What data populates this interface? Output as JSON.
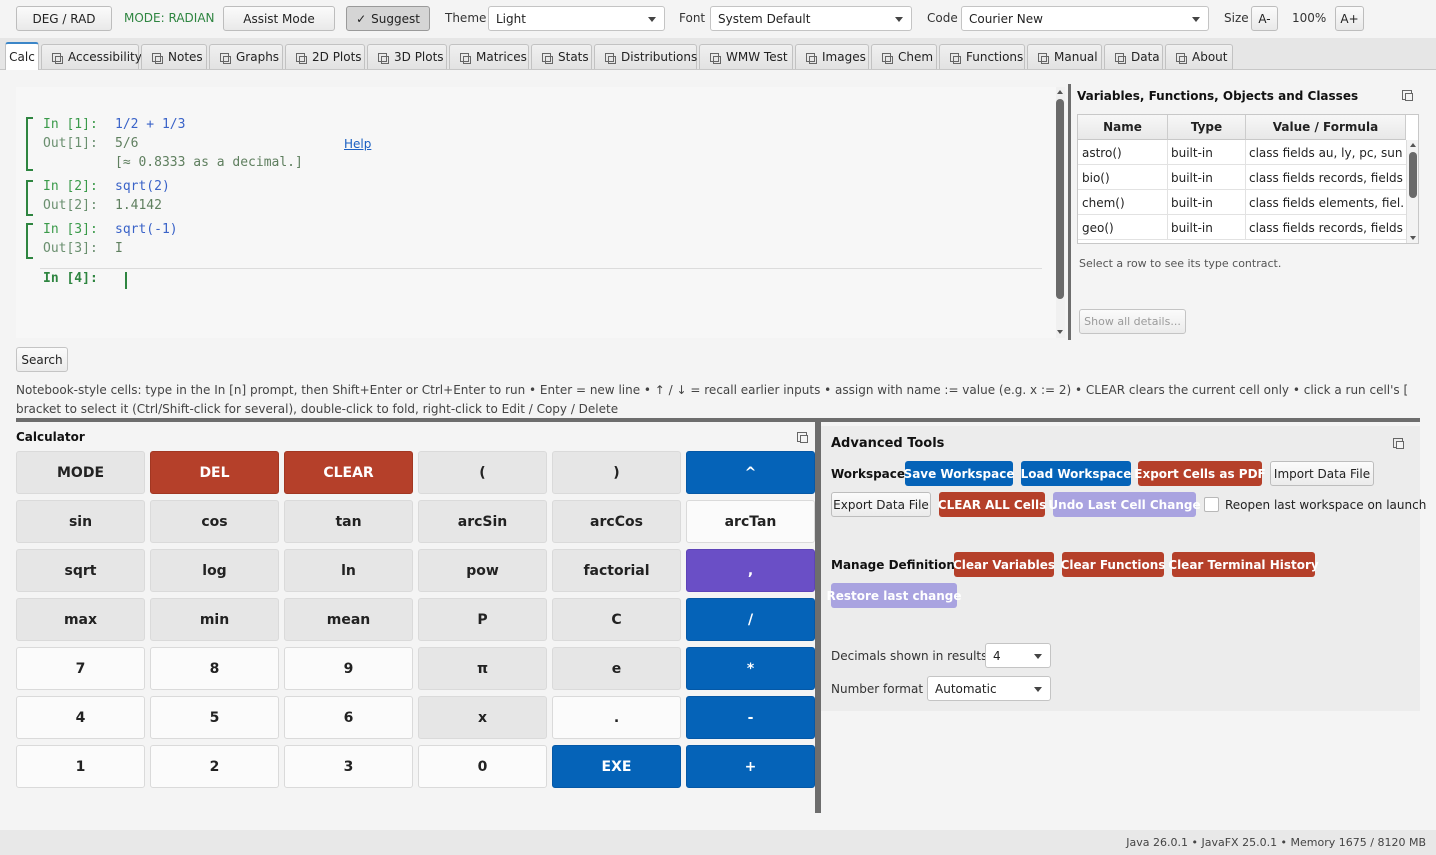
{
  "toolbar": {
    "deg_rad_label": "DEG / RAD",
    "mode_text": "MODE: RADIAN",
    "assist_mode_label": "Assist Mode",
    "suggest_label": "Suggest",
    "suggest_check": "✓",
    "theme_label": "Theme",
    "theme_value": "Light",
    "font_label": "Font",
    "font_value": "System Default",
    "code_label": "Code",
    "code_value": "Courier New",
    "size_label": "Size",
    "size_dec": "A-",
    "size_value": "100%",
    "size_inc": "A+"
  },
  "tabs": [
    "Calc",
    "Accessibility",
    "Notes",
    "Graphs",
    "2D Plots",
    "3D Plots",
    "Matrices",
    "Stats",
    "Distributions",
    "WMW Test",
    "Images",
    "Chem",
    "Functions",
    "Manual",
    "Data",
    "About"
  ],
  "notebook": {
    "cells": [
      {
        "in_prompt": "In [1]:",
        "input": "1/2 + 1/3",
        "out_prompt": "Out[1]:",
        "output": "5/6",
        "note": "[≈ 0.8333 as a decimal.]",
        "help": "Help"
      },
      {
        "in_prompt": "In [2]:",
        "input": "sqrt(2)",
        "out_prompt": "Out[2]:",
        "output": "1.4142"
      },
      {
        "in_prompt": "In [3]:",
        "input": "sqrt(-1)",
        "out_prompt": "Out[3]:",
        "output": "I"
      }
    ],
    "current_prompt": "In [4]:"
  },
  "variables": {
    "title": "Variables, Functions, Objects and Classes",
    "columns": [
      "Name",
      "Type",
      "Value / Formula"
    ],
    "rows": [
      {
        "name": "astro()",
        "type": "built-in",
        "value": "class fields au, ly, pc, sun..."
      },
      {
        "name": "bio()",
        "type": "built-in",
        "value": "class fields records, fields"
      },
      {
        "name": "chem()",
        "type": "built-in",
        "value": "class fields elements, fiel..."
      },
      {
        "name": "geo()",
        "type": "built-in",
        "value": "class fields records, fields"
      }
    ],
    "hint": "Select a row to see its type contract.",
    "show_details": "Show all details..."
  },
  "search_label": "Search",
  "help_text": "Notebook-style cells: type in the In [n] prompt, then Shift+Enter or Ctrl+Enter to run  •  Enter = new line  •  ↑ / ↓ = recall earlier inputs  •  assign with  name := value  (e.g. x := 2)  •  CLEAR clears the current cell only  •  click a run cell's [ bracket to select it (Ctrl/Shift-click for several), double-click to fold, right-click to Edit / Copy / Delete",
  "calculator": {
    "title": "Calculator",
    "keys": [
      [
        "MODE",
        "DEL",
        "CLEAR",
        "(",
        ")",
        "^"
      ],
      [
        "sin",
        "cos",
        "tan",
        "arcSin",
        "arcCos",
        "arcTan"
      ],
      [
        "sqrt",
        "log",
        "ln",
        "pow",
        "factorial",
        ","
      ],
      [
        "max",
        "min",
        "mean",
        "P",
        "C",
        "/"
      ],
      [
        "7",
        "8",
        "9",
        "π",
        "e",
        "*"
      ],
      [
        "4",
        "5",
        "6",
        "x",
        ".",
        "-"
      ],
      [
        "1",
        "2",
        "3",
        "0",
        "EXE",
        "+"
      ]
    ]
  },
  "advanced": {
    "title": "Advanced Tools",
    "workspace_label": "Workspace:",
    "save_workspace": "Save Workspace",
    "load_workspace": "Load Workspace",
    "export_pdf": "Export Cells as PDF",
    "import_data": "Import Data File",
    "export_data": "Export Data File",
    "clear_all": "CLEAR ALL Cells",
    "undo_last": "Undo Last Cell Change",
    "reopen_label": "Reopen last workspace on launch",
    "manage_label": "Manage Definitions:",
    "clear_variables": "Clear Variables",
    "clear_functions": "Clear Functions",
    "clear_history": "Clear Terminal History",
    "restore_last": "Restore last change",
    "decimals_label": "Decimals shown in results",
    "decimals_value": "4",
    "format_label": "Number format",
    "format_value": "Automatic"
  },
  "status": "Java 26.0.1  •  JavaFX 25.0.1  •  Memory 1675 / 8120 MB",
  "colors": {
    "accent_blue": "#0563b8",
    "danger_red": "#b5402a",
    "purple": "#6a4fc6",
    "lavender": "#a9a3e0",
    "prompt_green": "#2e8540"
  }
}
